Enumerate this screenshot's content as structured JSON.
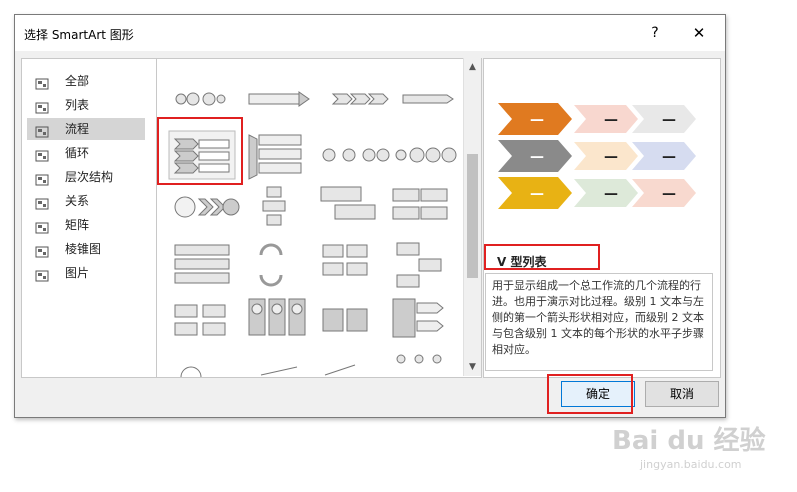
{
  "dialog": {
    "title": "选择 SmartArt 图形",
    "help": "?",
    "close": "✕"
  },
  "categories": [
    {
      "label": "全部",
      "icon": "all-icon"
    },
    {
      "label": "列表",
      "icon": "list-icon"
    },
    {
      "label": "流程",
      "icon": "process-icon",
      "selected": true
    },
    {
      "label": "循环",
      "icon": "cycle-icon"
    },
    {
      "label": "层次结构",
      "icon": "hierarchy-icon"
    },
    {
      "label": "关系",
      "icon": "relationship-icon"
    },
    {
      "label": "矩阵",
      "icon": "matrix-icon"
    },
    {
      "label": "棱锥图",
      "icon": "pyramid-icon"
    },
    {
      "label": "图片",
      "icon": "picture-icon"
    }
  ],
  "preview": {
    "name": "V 型列表",
    "description": "用于显示组成一个总工作流的几个流程的行进。也用于演示对比过程。级别 1 文本与左侧的第一个箭头形状相对应，而级别 2 文本与包含级别 1 文本的每个形状的水平子步骤相对应。",
    "placeholder": "—"
  },
  "buttons": {
    "ok": "确定",
    "cancel": "取消"
  },
  "watermark": {
    "brand": "Bai du 经验",
    "url": "jingyan.baidu.com"
  },
  "colors": {
    "selection_red": "#e02020",
    "row1": "#e07a20",
    "row2": "#8a8a8a",
    "row3": "#e8b214"
  }
}
